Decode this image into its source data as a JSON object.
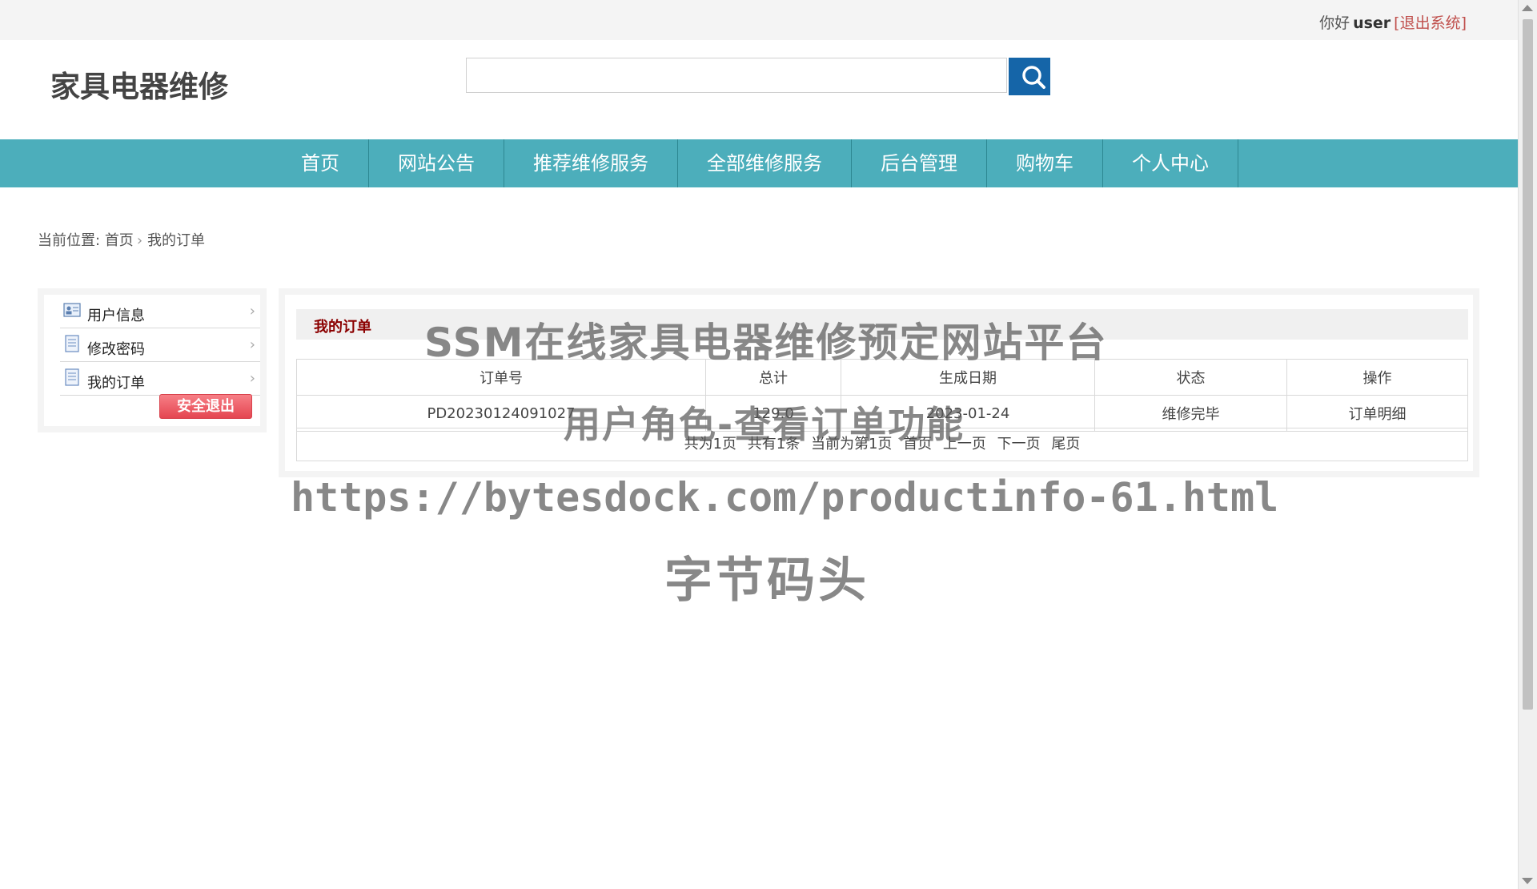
{
  "topbar": {
    "greeting": "你好",
    "username": "user",
    "logout": "[退出系统]"
  },
  "header": {
    "site_title": "家具电器维修",
    "search": {
      "value": "",
      "placeholder": ""
    }
  },
  "nav": {
    "items": [
      "首页",
      "网站公告",
      "推荐维修服务",
      "全部维修服务",
      "后台管理",
      "购物车",
      "个人中心"
    ]
  },
  "breadcrumb": {
    "prefix": "当前位置:",
    "home": "首页",
    "current": "我的订单"
  },
  "sidebar": {
    "items": [
      {
        "label": "用户信息",
        "icon": "user-card-icon"
      },
      {
        "label": "修改密码",
        "icon": "document-icon"
      },
      {
        "label": "我的订单",
        "icon": "document-icon"
      }
    ],
    "exit_button": "安全退出"
  },
  "main": {
    "title": "我的订单",
    "table": {
      "headers": [
        "订单号",
        "总计",
        "生成日期",
        "状态",
        "操作"
      ],
      "rows": [
        [
          "PD20230124091027",
          "129.0",
          "2023-01-24",
          "维修完毕",
          "订单明细"
        ]
      ]
    },
    "pager": {
      "pages": "共为1页",
      "count": "共有1条",
      "current": "当前为第1页",
      "first": "首页",
      "prev": "上一页",
      "next": "下一页",
      "last": "尾页"
    }
  },
  "watermark": {
    "line1": "SSM在线家具电器维修预定网站平台",
    "line2": "用户角色-查看订单功能",
    "line3": "https://bytesdock.com/productinfo-61.html",
    "line4": "字节码头"
  },
  "colors": {
    "nav": "#4caebb",
    "search_button": "#1565a8",
    "title_accent": "#8b0000",
    "exit_button": "#e44651"
  }
}
